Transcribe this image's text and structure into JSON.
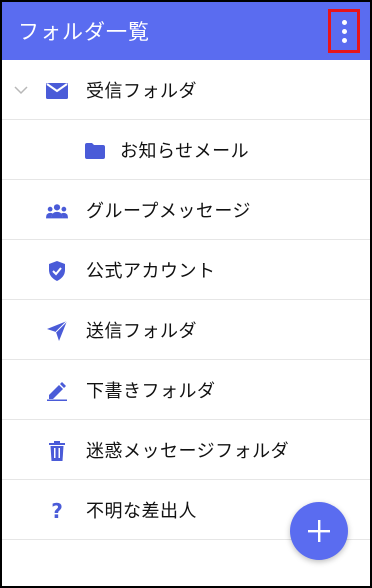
{
  "header": {
    "title": "フォルダ一覧",
    "menu_icon": "more-vert-icon"
  },
  "folders": [
    {
      "label": "受信フォルダ",
      "icon": "mail-icon"
    },
    {
      "label": "お知らせメール",
      "icon": "folder-icon"
    },
    {
      "label": "グループメッセージ",
      "icon": "group-icon"
    },
    {
      "label": "公式アカウント",
      "icon": "verified-shield-icon"
    },
    {
      "label": "送信フォルダ",
      "icon": "send-icon"
    },
    {
      "label": "下書きフォルダ",
      "icon": "edit-icon"
    },
    {
      "label": "迷惑メッセージフォルダ",
      "icon": "trash-icon"
    },
    {
      "label": "不明な差出人",
      "icon": "question-icon"
    }
  ],
  "fab": {
    "icon": "plus-icon"
  },
  "colors": {
    "accent": "#5a6cf0",
    "highlight": "#e8141a"
  }
}
